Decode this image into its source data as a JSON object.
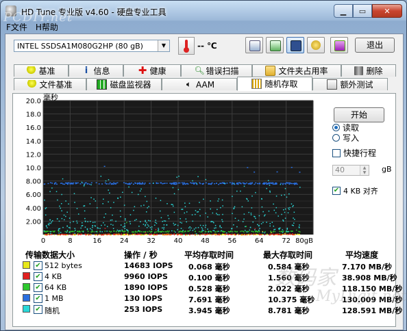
{
  "window": {
    "title": "HD Tune 专业版 v4.60 - 硬盘专业工具"
  },
  "watermark": {
    "top": "PCDIY.net",
    "bottom1": "数码家",
    "bottom2": "MyDigit.net"
  },
  "menu": {
    "file": "F文件",
    "help": "H帮助"
  },
  "toolbar": {
    "drive": "INTEL SSDSA1M080G2HP (80 gB)",
    "temperature": "-- ℃",
    "exit_label": "退出",
    "icons": [
      "copy-info-icon",
      "copy-chart-icon",
      "save-icon",
      "options-icon",
      "download-icon"
    ]
  },
  "tabs_row1": [
    "基准",
    "信息",
    "健康",
    "错误扫描",
    "文件夹占用率",
    "删除"
  ],
  "tabs_row2": [
    "文件基准",
    "磁盘监视器",
    "AAM",
    "随机存取",
    "额外测试"
  ],
  "active_tab": "随机存取",
  "chart_data": {
    "type": "scatter",
    "ylabel": "毫秒",
    "yticks": [
      "20.0",
      "18.0",
      "16.0",
      "14.0",
      "12.0",
      "10.0",
      "8.00",
      "6.00",
      "4.00",
      "2.00"
    ],
    "xticks": [
      "0",
      "8",
      "16",
      "24",
      "32",
      "40",
      "48",
      "56",
      "64",
      "72",
      "80gB"
    ],
    "xlim": [
      0,
      80
    ],
    "ylim": [
      0,
      20
    ],
    "grid": true,
    "background": "#1a1a1a",
    "series": [
      {
        "name": "512 bytes",
        "color": "#e8e81a",
        "mean": 0.068,
        "max": 0.584
      },
      {
        "name": "4 KB",
        "color": "#e02020",
        "mean": 0.1,
        "max": 1.56
      },
      {
        "name": "64 KB",
        "color": "#2ec82e",
        "mean": 0.528,
        "max": 2.022
      },
      {
        "name": "1 MB",
        "color": "#2a6fe0",
        "mean": 7.691,
        "max": 10.375
      },
      {
        "name": "随机",
        "color": "#2ad8d8",
        "mean": 3.945,
        "max": 8.781
      }
    ]
  },
  "controls": {
    "start_label": "开始",
    "read_label": "读取",
    "write_label": "写入",
    "short_stroke_label": "快捷行程",
    "short_stroke_value": "40",
    "short_stroke_unit": "gB",
    "align_label": "4 KB 对齐"
  },
  "results": {
    "headers": [
      "传输数据大小",
      "操作 / 秒",
      "平均存取时间",
      "最大存取时间",
      "平均速度"
    ],
    "rows": [
      {
        "size": "512 bytes",
        "ops": "14683 IOPS",
        "avg": "0.068 毫秒",
        "max": "0.584 毫秒",
        "speed": "7.170 MB/秒",
        "color": "#e8e81a"
      },
      {
        "size": "4 KB",
        "ops": "9960 IOPS",
        "avg": "0.100 毫秒",
        "max": "1.560 毫秒",
        "speed": "38.908 MB/秒",
        "color": "#e02020"
      },
      {
        "size": "64 KB",
        "ops": "1890 IOPS",
        "avg": "0.528 毫秒",
        "max": "2.022 毫秒",
        "speed": "118.150 MB/秒",
        "color": "#2ec82e"
      },
      {
        "size": "1 MB",
        "ops": "130 IOPS",
        "avg": "7.691 毫秒",
        "max": "10.375 毫秒",
        "speed": "130.009 MB/秒",
        "color": "#2a6fe0"
      },
      {
        "size": "随机",
        "ops": "253 IOPS",
        "avg": "3.945 毫秒",
        "max": "8.781 毫秒",
        "speed": "128.591 MB/秒",
        "color": "#2ad8d8"
      }
    ]
  }
}
